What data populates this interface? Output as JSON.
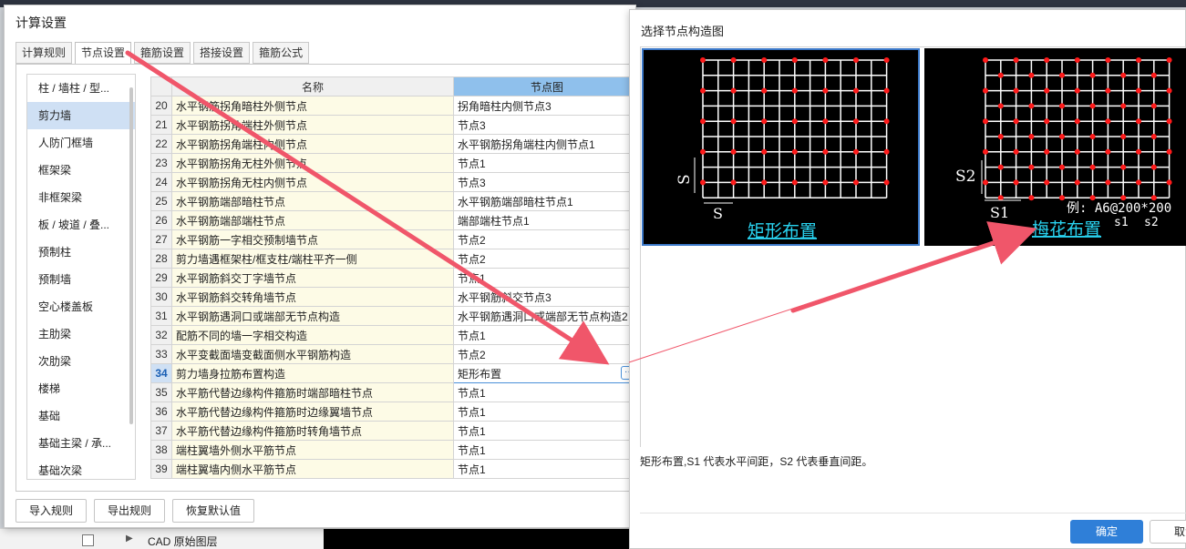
{
  "left_dialog": {
    "title": "计算设置",
    "tabs": [
      {
        "label": "计算规则"
      },
      {
        "label": "节点设置"
      },
      {
        "label": "箍筋设置"
      },
      {
        "label": "搭接设置"
      },
      {
        "label": "箍筋公式"
      }
    ],
    "categories": [
      {
        "label": "柱 / 墙柱 / 型..."
      },
      {
        "label": "剪力墙"
      },
      {
        "label": "人防门框墙"
      },
      {
        "label": "框架梁"
      },
      {
        "label": "非框架梁"
      },
      {
        "label": "板 / 坡道 / 叠..."
      },
      {
        "label": "预制柱"
      },
      {
        "label": "预制墙"
      },
      {
        "label": "空心楼盖板"
      },
      {
        "label": "主肋梁"
      },
      {
        "label": "次肋梁"
      },
      {
        "label": "楼梯"
      },
      {
        "label": "基础"
      },
      {
        "label": "基础主梁 / 承..."
      },
      {
        "label": "基础次梁"
      }
    ],
    "table": {
      "headers": {
        "name": "名称",
        "node": "节点图"
      },
      "rows": [
        {
          "num": "20",
          "name": "水平钢筋拐角暗柱外侧节点",
          "node": "拐角暗柱内侧节点3"
        },
        {
          "num": "21",
          "name": "水平钢筋拐角端柱外侧节点",
          "node": "节点3"
        },
        {
          "num": "22",
          "name": "水平钢筋拐角端柱内侧节点",
          "node": "水平钢筋拐角端柱内侧节点1"
        },
        {
          "num": "23",
          "name": "水平钢筋拐角无柱外侧节点",
          "node": "节点1"
        },
        {
          "num": "24",
          "name": "水平钢筋拐角无柱内侧节点",
          "node": "节点3"
        },
        {
          "num": "25",
          "name": "水平钢筋端部暗柱节点",
          "node": "水平钢筋端部暗柱节点1"
        },
        {
          "num": "26",
          "name": "水平钢筋端部端柱节点",
          "node": "端部端柱节点1"
        },
        {
          "num": "27",
          "name": "水平钢筋一字相交预制墙节点",
          "node": "节点2"
        },
        {
          "num": "28",
          "name": "剪力墙遇框架柱/框支柱/端柱平齐一侧",
          "node": "节点2"
        },
        {
          "num": "29",
          "name": "水平钢筋斜交丁字墙节点",
          "node": "节点1"
        },
        {
          "num": "30",
          "name": "水平钢筋斜交转角墙节点",
          "node": "水平钢筋斜交节点3"
        },
        {
          "num": "31",
          "name": "水平钢筋遇洞口或端部无节点构造",
          "node": "水平钢筋遇洞口或端部无节点构造2"
        },
        {
          "num": "32",
          "name": "配筋不同的墙一字相交构造",
          "node": "节点1"
        },
        {
          "num": "33",
          "name": "水平变截面墙变截面侧水平钢筋构造",
          "node": "节点2"
        },
        {
          "num": "34",
          "name": "剪力墙身拉筋布置构造",
          "node": "矩形布置",
          "selected": true
        },
        {
          "num": "35",
          "name": "水平筋代替边缘构件箍筋时端部暗柱节点",
          "node": "节点1"
        },
        {
          "num": "36",
          "name": "水平筋代替边缘构件箍筋时边缘翼墙节点",
          "node": "节点1"
        },
        {
          "num": "37",
          "name": "水平筋代替边缘构件箍筋时转角墙节点",
          "node": "节点1"
        },
        {
          "num": "38",
          "name": "端柱翼墙外侧水平筋节点",
          "node": "节点1"
        },
        {
          "num": "39",
          "name": "端柱翼墙内侧水平筋节点",
          "node": "节点1"
        }
      ]
    },
    "footer": {
      "import": "导入规则",
      "export": "导出规则",
      "restore": "恢复默认值"
    }
  },
  "right_dialog": {
    "title": "选择节点构造图",
    "option1": {
      "caption": "矩形布置",
      "label_s_vertical": "S",
      "label_s_horizontal": "S"
    },
    "option2": {
      "caption": "梅花布置",
      "label_s2": "S2",
      "label_s1": "S1",
      "example": "例: A6@200*200",
      "sub_s1": "s1",
      "sub_s2": "s2"
    },
    "description": "矩形布置,S1 代表水平间距，S2 代表垂直间距。",
    "ok": "确定",
    "cancel": "取消"
  },
  "background": {
    "layer_label": "CAD 原始图层"
  },
  "colors": {
    "grid_line": "#ffffff",
    "dot": "#ff1a1a",
    "caption": "#29d3f0",
    "arrow": "#f0566a",
    "accent": "#2f7fd8"
  }
}
